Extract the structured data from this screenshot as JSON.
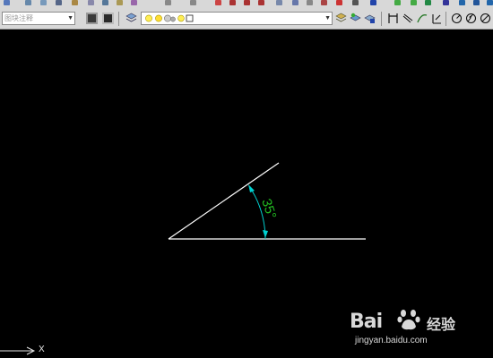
{
  "toolbar": {
    "text_style_combo": {
      "value": "图块注释"
    },
    "layer_combo": {
      "value": ""
    }
  },
  "drawing": {
    "angle_dimension_text": "35°",
    "colors": {
      "lines": "#ffffff",
      "dimension_text": "#22bb22",
      "dimension_arc": "#00d0d0",
      "background": "#000000"
    }
  },
  "ucs_icon": {
    "axis_label": "X"
  },
  "watermark": {
    "brand": "Bai",
    "brand_cn": "经验",
    "url": "jingyan.baidu.com"
  }
}
